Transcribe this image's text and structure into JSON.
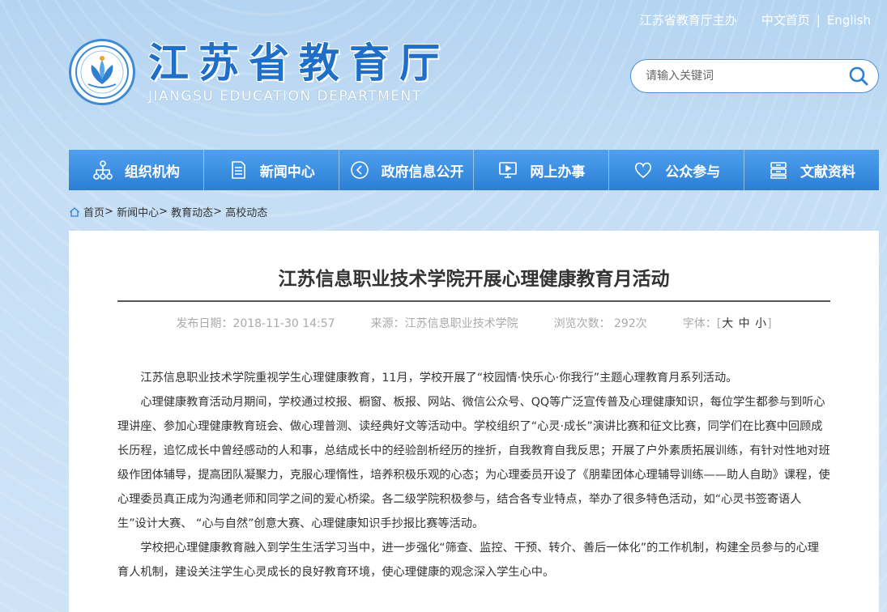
{
  "header": {
    "sponsor": "江苏省教育厅主办",
    "home_cn": "中文首页",
    "divider": "|",
    "english": "English",
    "logo_cn": "江苏省教育厅",
    "logo_en": "JIANGSU EDUCATION DEPARTMENT"
  },
  "search": {
    "placeholder": "请输入关键词"
  },
  "nav": [
    {
      "label": "组织机构",
      "icon": "org-chart-icon"
    },
    {
      "label": "新闻中心",
      "icon": "document-icon"
    },
    {
      "label": "政府信息公开",
      "icon": "play-circle-icon"
    },
    {
      "label": "网上办事",
      "icon": "monitor-icon"
    },
    {
      "label": "公众参与",
      "icon": "heart-icon"
    },
    {
      "label": "文献资料",
      "icon": "archive-icon"
    }
  ],
  "breadcrumb": {
    "home": "首页",
    "news": "新闻中心",
    "edu": "教育动态",
    "college": "高校动态",
    "sep": ">"
  },
  "article": {
    "title": "江苏信息职业技术学院开展心理健康教育月活动",
    "date": "发布日期：2018-11-30 14:57",
    "source": "来源：江苏信息职业技术学院",
    "views": "浏览次数： 292次",
    "font_label": "字体：",
    "font_open": "[",
    "font_large": "大",
    "font_medium": "中",
    "font_small": "小",
    "font_close": "]",
    "paragraphs": [
      "江苏信息职业技术学院重视学生心理健康教育，11月，学校开展了“校园情·快乐心·你我行”主题心理教育月系列活动。",
      "心理健康教育活动月期间，学校通过校报、橱窗、板报、网站、微信公众号、QQ等广泛宣传普及心理健康知识，每位学生都参与到听心理讲座、参加心理健康教育班会、做心理普测、读经典好文等活动中。学校组织了“心灵·成长”演讲比赛和征文比赛，同学们在比赛中回顾成长历程，追忆成长中曾经感动的人和事，总结成长中的经验剖析经历的挫折，自我教育自我反思；开展了户外素质拓展训练，有针对性地对班级作团体辅导，提高团队凝聚力，克服心理惰性，培养积极乐观的心态；为心理委员开设了《朋辈团体心理辅导训练——助人自助》课程，使心理委员真正成为沟通老师和同学之间的爱心桥梁。各二级学院积极参与，结合各专业特点，举办了很多特色活动，如“心灵书签寄语人生”设计大赛、 “心与自然”创意大赛、心理健康知识手抄报比赛等活动。",
      "学校把心理健康教育融入到学生生活学习当中，进一步强化“筛查、监控、干预、转介、善后一体化”的工作机制，构建全员参与的心理育人机制，建设关注学生心灵成长的良好教育环境，使心理健康的观念深入学生心中。"
    ]
  },
  "colors": {
    "nav_blue": "#2c7ed5",
    "brand_blue": "#1f6fc8",
    "page_bg": "#bcd8f2"
  }
}
